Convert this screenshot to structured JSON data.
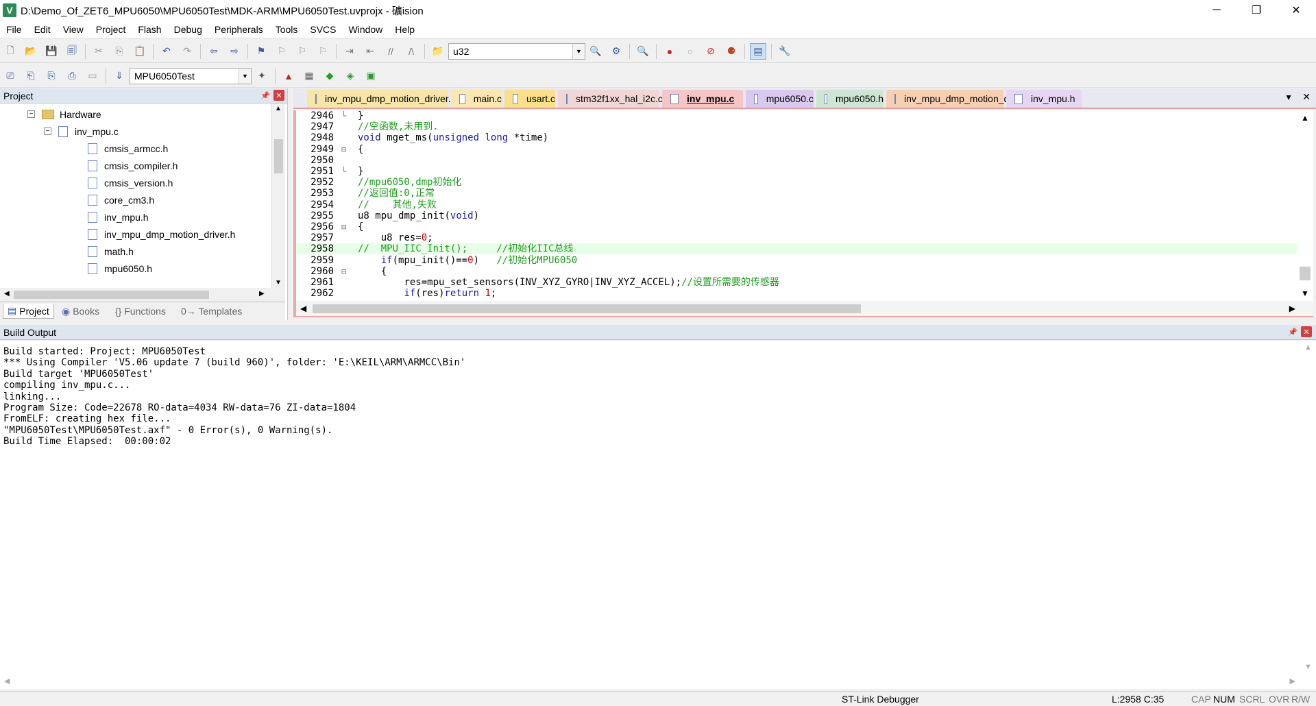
{
  "window": {
    "title": "D:\\Demo_Of_ZET6_MPU6050\\MPU6050Test\\MDK-ARM\\MPU6050Test.uvprojx - 礦ision",
    "icon": "uvision-app-icon",
    "minimize": "─",
    "restore": "❐",
    "close": "✕"
  },
  "menu": [
    "File",
    "Edit",
    "View",
    "Project",
    "Flash",
    "Debug",
    "Peripherals",
    "Tools",
    "SVCS",
    "Window",
    "Help"
  ],
  "toolbar1": {
    "find_combo_value": "u32"
  },
  "toolbar2": {
    "target_combo_value": "MPU6050Test"
  },
  "project_panel": {
    "title": "Project",
    "tree": [
      {
        "label": "Hardware",
        "kind": "folder",
        "expander": "−"
      },
      {
        "label": "inv_mpu.c",
        "kind": "file",
        "expander": "−"
      },
      {
        "label": "cmsis_armcc.h",
        "kind": "file"
      },
      {
        "label": "cmsis_compiler.h",
        "kind": "file"
      },
      {
        "label": "cmsis_version.h",
        "kind": "file"
      },
      {
        "label": "core_cm3.h",
        "kind": "file"
      },
      {
        "label": "inv_mpu.h",
        "kind": "file"
      },
      {
        "label": "inv_mpu_dmp_motion_driver.h",
        "kind": "file"
      },
      {
        "label": "math.h",
        "kind": "file"
      },
      {
        "label": "mpu6050.h",
        "kind": "file"
      }
    ],
    "bottom_tabs": [
      "Project",
      "Books",
      "{} Functions",
      "0→ Templates"
    ]
  },
  "editor_tabs": [
    {
      "label": "inv_mpu_dmp_motion_driver.h",
      "color": "#f7e6a8"
    },
    {
      "label": "main.c",
      "color": "#fde7b0"
    },
    {
      "label": "usart.c",
      "color": "#fbe08a"
    },
    {
      "label": "stm32f1xx_hal_i2c.c",
      "color": "#f1d6d6"
    },
    {
      "label": "inv_mpu.c",
      "color": "#f6c6c6"
    },
    {
      "label": "mpu6050.c",
      "color": "#d9c9ef"
    },
    {
      "label": "mpu6050.h",
      "color": "#cde6d4"
    },
    {
      "label": "inv_mpu_dmp_motion_driver.c",
      "color": "#f7cfb3"
    },
    {
      "label": "inv_mpu.h",
      "color": "#e6d6f3"
    }
  ],
  "code_lines": [
    {
      "n": "2946",
      "fold": "└",
      "text": "}"
    },
    {
      "n": "2947",
      "fold": "",
      "text": "//空函数,未用到."
    },
    {
      "n": "2948",
      "fold": "",
      "text": "void mget_ms(unsigned long *time)"
    },
    {
      "n": "2949",
      "fold": "⊟",
      "text": "{"
    },
    {
      "n": "2950",
      "fold": "",
      "text": ""
    },
    {
      "n": "2951",
      "fold": "└",
      "text": "}"
    },
    {
      "n": "2952",
      "fold": "",
      "text": "//mpu6050,dmp初始化"
    },
    {
      "n": "2953",
      "fold": "",
      "text": "//返回值:0,正常"
    },
    {
      "n": "2954",
      "fold": "",
      "text": "//    其他,失败"
    },
    {
      "n": "2955",
      "fold": "",
      "text": "u8 mpu_dmp_init(void)"
    },
    {
      "n": "2956",
      "fold": "⊟",
      "text": "{"
    },
    {
      "n": "2957",
      "fold": "",
      "text": "    u8 res=0;"
    },
    {
      "n": "2958",
      "fold": "",
      "text": "//  MPU_IIC_Init();     //初始化IIC总线"
    },
    {
      "n": "2959",
      "fold": "",
      "text": "    if(mpu_init()==0)   //初始化MPU6050"
    },
    {
      "n": "2960",
      "fold": "⊟",
      "text": "    {"
    },
    {
      "n": "2961",
      "fold": "",
      "text": "        res=mpu_set_sensors(INV_XYZ_GYRO|INV_XYZ_ACCEL);//设置所需要的传感器"
    },
    {
      "n": "2962",
      "fold": "",
      "text": "        if(res)return 1;"
    }
  ],
  "build_output": {
    "title": "Build Output",
    "lines": [
      "Build started: Project: MPU6050Test",
      "*** Using Compiler 'V5.06 update 7 (build 960)', folder: 'E:\\KEIL\\ARM\\ARMCC\\Bin'",
      "Build target 'MPU6050Test'",
      "compiling inv_mpu.c...",
      "linking...",
      "Program Size: Code=22678 RO-data=4034 RW-data=76 ZI-data=1804",
      "FromELF: creating hex file...",
      "\"MPU6050Test\\MPU6050Test.axf\" - 0 Error(s), 0 Warning(s).",
      "Build Time Elapsed:  00:00:02"
    ]
  },
  "status": {
    "debugger": "ST-Link Debugger",
    "position": "L:2958 C:35",
    "flags": [
      "CAP",
      "NUM",
      "SCRL",
      "OVR",
      "R/W"
    ]
  }
}
